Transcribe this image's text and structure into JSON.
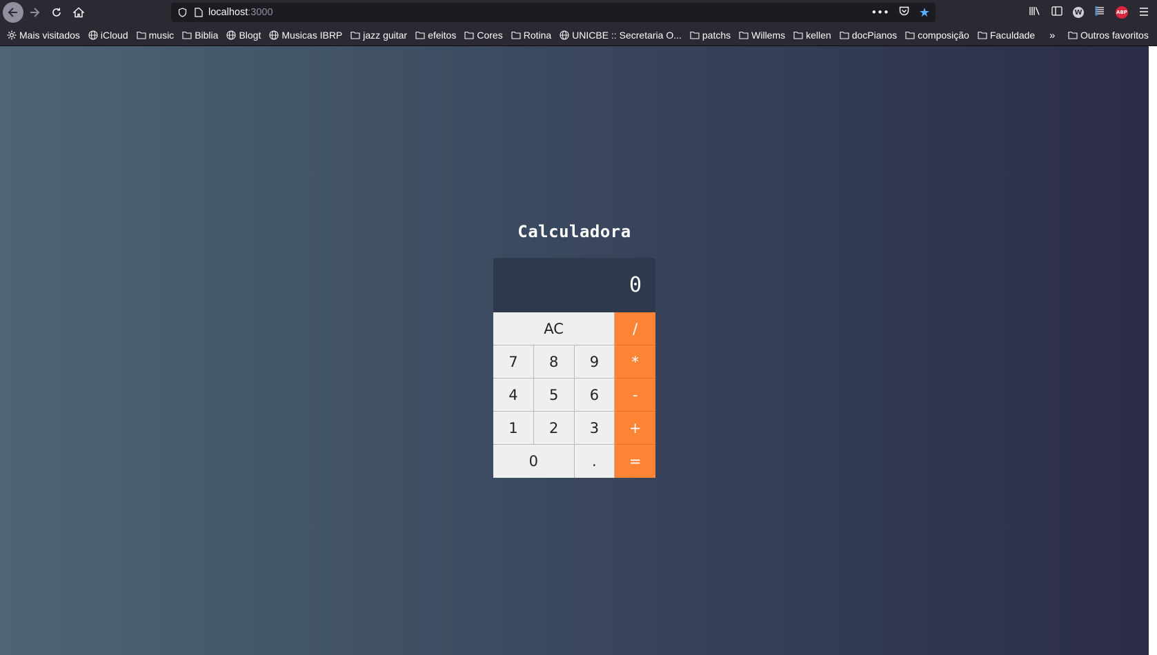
{
  "browser": {
    "url_host": "localhost",
    "url_port": ":3000"
  },
  "bookmarks": [
    {
      "label": "Mais visitados",
      "icon": "gear-icon"
    },
    {
      "label": "iCloud",
      "icon": "globe-icon"
    },
    {
      "label": "music",
      "icon": "folder-icon"
    },
    {
      "label": "Biblia",
      "icon": "folder-icon"
    },
    {
      "label": "Blogt",
      "icon": "globe-icon"
    },
    {
      "label": "Musicas IBRP",
      "icon": "globe-icon"
    },
    {
      "label": "jazz guitar",
      "icon": "folder-icon"
    },
    {
      "label": "efeitos",
      "icon": "folder-icon"
    },
    {
      "label": "Cores",
      "icon": "folder-icon"
    },
    {
      "label": "Rotina",
      "icon": "folder-icon"
    },
    {
      "label": "UNICBE :: Secretaria O...",
      "icon": "globe-icon"
    },
    {
      "label": "patchs",
      "icon": "folder-icon"
    },
    {
      "label": "Willems",
      "icon": "folder-icon"
    },
    {
      "label": "kellen",
      "icon": "folder-icon"
    },
    {
      "label": "docPianos",
      "icon": "folder-icon"
    },
    {
      "label": "composição",
      "icon": "folder-icon"
    },
    {
      "label": "Faculdade",
      "icon": "folder-icon"
    }
  ],
  "bookmarks_other": "Outros favoritos",
  "calculator": {
    "title": "Calculadora",
    "display": "0",
    "keys": {
      "clear": "AC",
      "divide": "/",
      "seven": "7",
      "eight": "8",
      "nine": "9",
      "multiply": "*",
      "four": "4",
      "five": "5",
      "six": "6",
      "subtract": "-",
      "one": "1",
      "two": "2",
      "three": "3",
      "add": "+",
      "zero": "0",
      "decimal": ".",
      "equals": "="
    }
  },
  "colors": {
    "operator": "#fd8434",
    "display_bg": "#2e3a4b",
    "key_bg": "#efefef"
  }
}
